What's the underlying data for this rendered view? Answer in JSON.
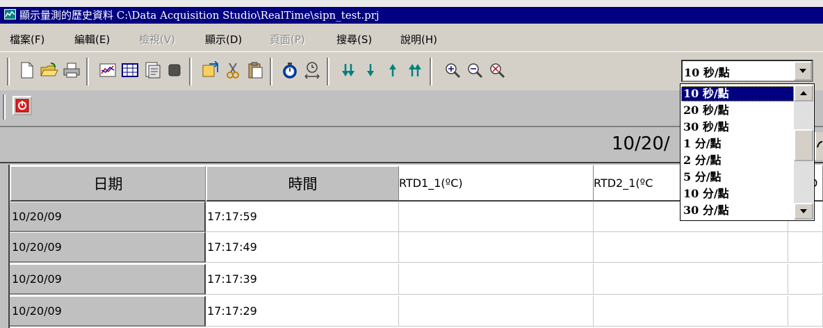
{
  "titlebar": {
    "title": "顯示量測的歷史資料 C:\\Data Acquisition Studio\\RealTime\\sipn_test.prj"
  },
  "menu": [
    {
      "label": "檔案(F)",
      "enabled": true
    },
    {
      "label": "編輯(E)",
      "enabled": true
    },
    {
      "label": "檢視(V)",
      "enabled": false
    },
    {
      "label": "顯示(D)",
      "enabled": true
    },
    {
      "label": "頁面(P)",
      "enabled": false
    },
    {
      "label": "搜尋(S)",
      "enabled": true
    },
    {
      "label": "說明(H)",
      "enabled": true
    }
  ],
  "toolbar": {
    "interval_select": {
      "value": "10 秒/點",
      "options": [
        "10 秒/點",
        "20 秒/點",
        "30 秒/點",
        "1 分/點",
        "2 分/點",
        "5 分/點",
        "10 分/點",
        "30 分/點"
      ],
      "selected_index": 0
    }
  },
  "date_header": "10/20/",
  "table": {
    "columns": [
      "日期",
      "時間",
      "RTD1_1(ºC)",
      "RTD2_1(ºC",
      "D"
    ],
    "rows": [
      {
        "date": "10/20/09",
        "time": "17:17:59"
      },
      {
        "date": "10/20/09",
        "time": "17:17:49"
      },
      {
        "date": "10/20/09",
        "time": "17:17:39"
      },
      {
        "date": "10/20/09",
        "time": "17:17:29"
      }
    ]
  },
  "colors": {
    "title_bg": "#000080",
    "window_bg": "#c0c0c0",
    "selection": "#000080"
  }
}
